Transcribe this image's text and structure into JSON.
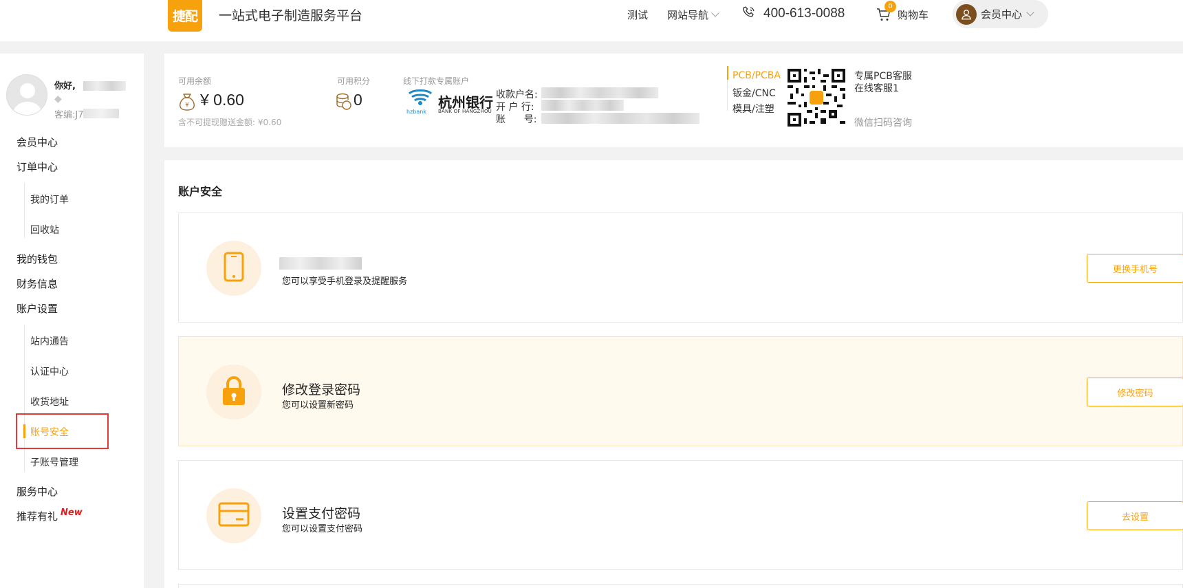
{
  "header": {
    "logo_text": "捷配",
    "slogan": "一站式电子制造服务平台",
    "nav_test": "测试",
    "nav_site": "网站导航",
    "phone": "400-613-0088",
    "cart_count": "0",
    "cart_label": "购物车",
    "member_label": "会员中心"
  },
  "profile": {
    "greeting": "你好,",
    "customer_no": "客编:J7"
  },
  "sidebar": {
    "member_center": "会员中心",
    "order_center": "订单中心",
    "my_orders": "我的订单",
    "recycle": "回收站",
    "wallet": "我的钱包",
    "finance": "财务信息",
    "account_settings": "账户设置",
    "notices": "站内通告",
    "auth_center": "认证中心",
    "address": "收货地址",
    "account_security": "账号安全",
    "sub_accounts": "子账号管理",
    "service_center": "服务中心",
    "referral": "推荐有礼",
    "new_tag": "New"
  },
  "infobar": {
    "balance_label": "可用余额",
    "balance_value": "¥ 0.60",
    "balance_note": "含不可提现赠送金额: ¥0.60",
    "points_label": "可用积分",
    "points_value": "0",
    "offline_label": "线下打款专属账户",
    "bank_name": "杭州银行",
    "bank_en": "BANK OF HANGZHOU",
    "bank_short": "hzbank",
    "payee_label": "收款户名:",
    "bank_label": "开 户 行:",
    "account_label": "账      号:",
    "tabs": [
      "PCB/PCBA",
      "钣金/CNC",
      "模具/注塑"
    ],
    "qr_title": "专属PCB客服",
    "qr_sub": "在线客服1",
    "qr_note": "微信扫码咨询"
  },
  "security": {
    "title": "账户安全",
    "phone_desc": "您可以享受手机登录及提醒服务",
    "phone_btn": "更换手机号",
    "pwd_title": "修改登录密码",
    "pwd_desc": "您可以设置新密码",
    "pwd_btn": "修改密码",
    "pay_title": "设置支付密码",
    "pay_desc": "您可以设置支付密码",
    "pay_btn": "去设置"
  },
  "colors": {
    "accent": "#f7a20c",
    "highlight_box": "#e03a3a",
    "new_tag": "#e0201e"
  }
}
